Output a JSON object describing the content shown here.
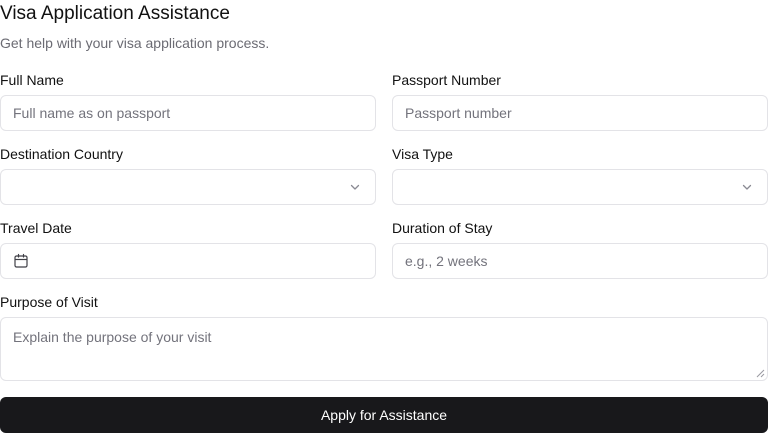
{
  "header": {
    "title": "Visa Application Assistance",
    "subtitle": "Get help with your visa application process."
  },
  "form": {
    "full_name": {
      "label": "Full Name",
      "placeholder": "Full name as on passport",
      "value": ""
    },
    "passport_number": {
      "label": "Passport Number",
      "placeholder": "Passport number",
      "value": ""
    },
    "destination_country": {
      "label": "Destination Country",
      "value": "",
      "icon": "chevron-down-icon"
    },
    "visa_type": {
      "label": "Visa Type",
      "value": "",
      "icon": "chevron-down-icon"
    },
    "travel_date": {
      "label": "Travel Date",
      "value": "",
      "icon": "calendar-icon"
    },
    "duration_of_stay": {
      "label": "Duration of Stay",
      "placeholder": "e.g., 2 weeks",
      "value": ""
    },
    "purpose_of_visit": {
      "label": "Purpose of Visit",
      "placeholder": "Explain the purpose of your visit",
      "value": ""
    },
    "submit_label": "Apply for Assistance"
  },
  "colors": {
    "button_bg": "#18181b",
    "button_text": "#ffffff",
    "border": "#e3e3e7",
    "placeholder": "#73737c"
  }
}
